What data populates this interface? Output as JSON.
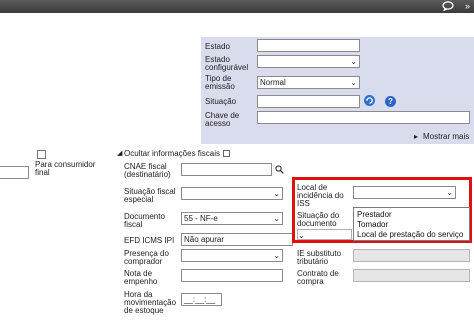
{
  "topbar": {
    "more_glyph": "»"
  },
  "panel": {
    "estado_label": "Estado",
    "estado_conf_label": [
      "Estado",
      "configurável"
    ],
    "tipo_emissao_label": [
      "Tipo de",
      "emissão"
    ],
    "tipo_emissao_value": "Normal",
    "situacao_label": "Situação",
    "chave_label": [
      "Chave de",
      "acesso"
    ],
    "mostrar_mais": "Mostrar mais"
  },
  "left": {
    "consumidor_label": [
      "Para consumidor",
      "final"
    ]
  },
  "fiscal": {
    "section_title": "Ocultar informações fiscais",
    "cnae_label": [
      "CNAE fiscal",
      "(destinatário)"
    ],
    "sit_fiscal_label": [
      "Situação fiscal",
      "especial"
    ],
    "doc_fiscal_label": [
      "Documento",
      "fiscal"
    ],
    "doc_fiscal_value": "55 - NF-e",
    "efd_label": "EFD ICMS IPI",
    "efd_value": "Não apurar",
    "presenca_label": [
      "Presença do",
      "comprador"
    ],
    "nota_empenho_label": [
      "Nota de",
      "empenho"
    ],
    "hora_label": [
      "Hora da",
      "movimentação",
      "de estoque"
    ],
    "hora_value": "__:__:__"
  },
  "right": {
    "local_label": [
      "Local de",
      "incidência do",
      "ISS"
    ],
    "sit_doc_label": [
      "Situação do",
      "documento"
    ],
    "ie_label": [
      "IE substituto",
      "tributário"
    ],
    "contrato_label": [
      "Contrato de",
      "compra"
    ],
    "local_options": [
      "Prestador",
      "Tomador",
      "Local de prestação do serviço"
    ]
  },
  "colors": {
    "highlight": "#e01010",
    "panel_bg": "#d8dcec",
    "help_icon": "#2b64c8"
  }
}
